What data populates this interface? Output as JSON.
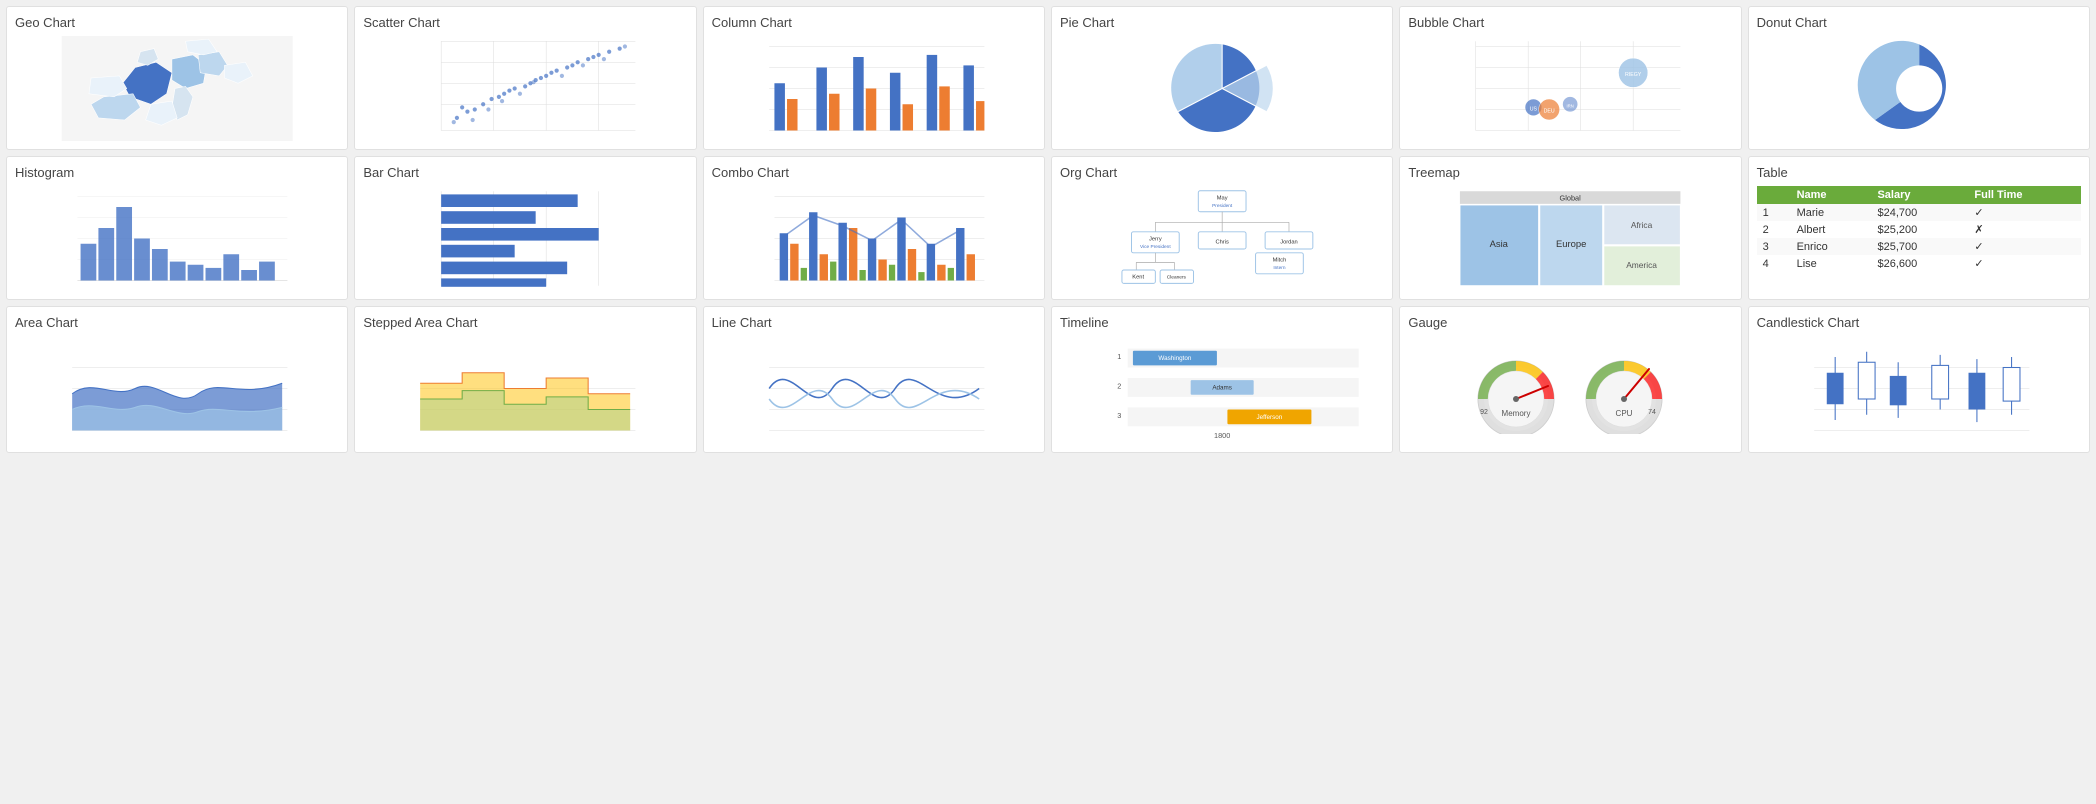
{
  "cards": [
    {
      "id": "geo-chart",
      "title": "Geo Chart"
    },
    {
      "id": "scatter-chart",
      "title": "Scatter Chart"
    },
    {
      "id": "column-chart",
      "title": "Column Chart"
    },
    {
      "id": "pie-chart",
      "title": "Pie Chart"
    },
    {
      "id": "bubble-chart",
      "title": "Bubble Chart"
    },
    {
      "id": "donut-chart",
      "title": "Donut Chart"
    },
    {
      "id": "histogram",
      "title": "Histogram"
    },
    {
      "id": "bar-chart",
      "title": "Bar Chart"
    },
    {
      "id": "combo-chart",
      "title": "Combo Chart"
    },
    {
      "id": "org-chart",
      "title": "Org Chart"
    },
    {
      "id": "treemap",
      "title": "Treemap"
    },
    {
      "id": "table",
      "title": "Table"
    },
    {
      "id": "area-chart",
      "title": "Area Chart"
    },
    {
      "id": "stepped-area",
      "title": "Stepped Area Chart"
    },
    {
      "id": "line-chart",
      "title": "Line Chart"
    },
    {
      "id": "timeline",
      "title": "Timeline"
    },
    {
      "id": "gauge",
      "title": "Gauge"
    },
    {
      "id": "candlestick",
      "title": "Candlestick Chart"
    }
  ],
  "table": {
    "headers": [
      "Name",
      "Salary",
      "Full Time"
    ],
    "rows": [
      [
        "1",
        "Marie",
        "$24,700",
        "✓"
      ],
      [
        "2",
        "Albert",
        "$25,200",
        "✗"
      ],
      [
        "3",
        "Enrico",
        "$25,700",
        "✓"
      ],
      [
        "4",
        "Lise",
        "$26,600",
        "✓"
      ]
    ]
  },
  "timeline": {
    "rows": [
      {
        "id": "1",
        "label": "Washington",
        "color": "#5b9bd5"
      },
      {
        "id": "2",
        "label": "Adams",
        "color": "#9dc3e6"
      },
      {
        "id": "3",
        "label": "Jefferson",
        "color": "#f0a500"
      }
    ],
    "footer": "1800"
  },
  "gauge": {
    "memory": {
      "label": "Memory",
      "value": 92
    },
    "cpu": {
      "label": "CPU",
      "value": 74
    }
  }
}
